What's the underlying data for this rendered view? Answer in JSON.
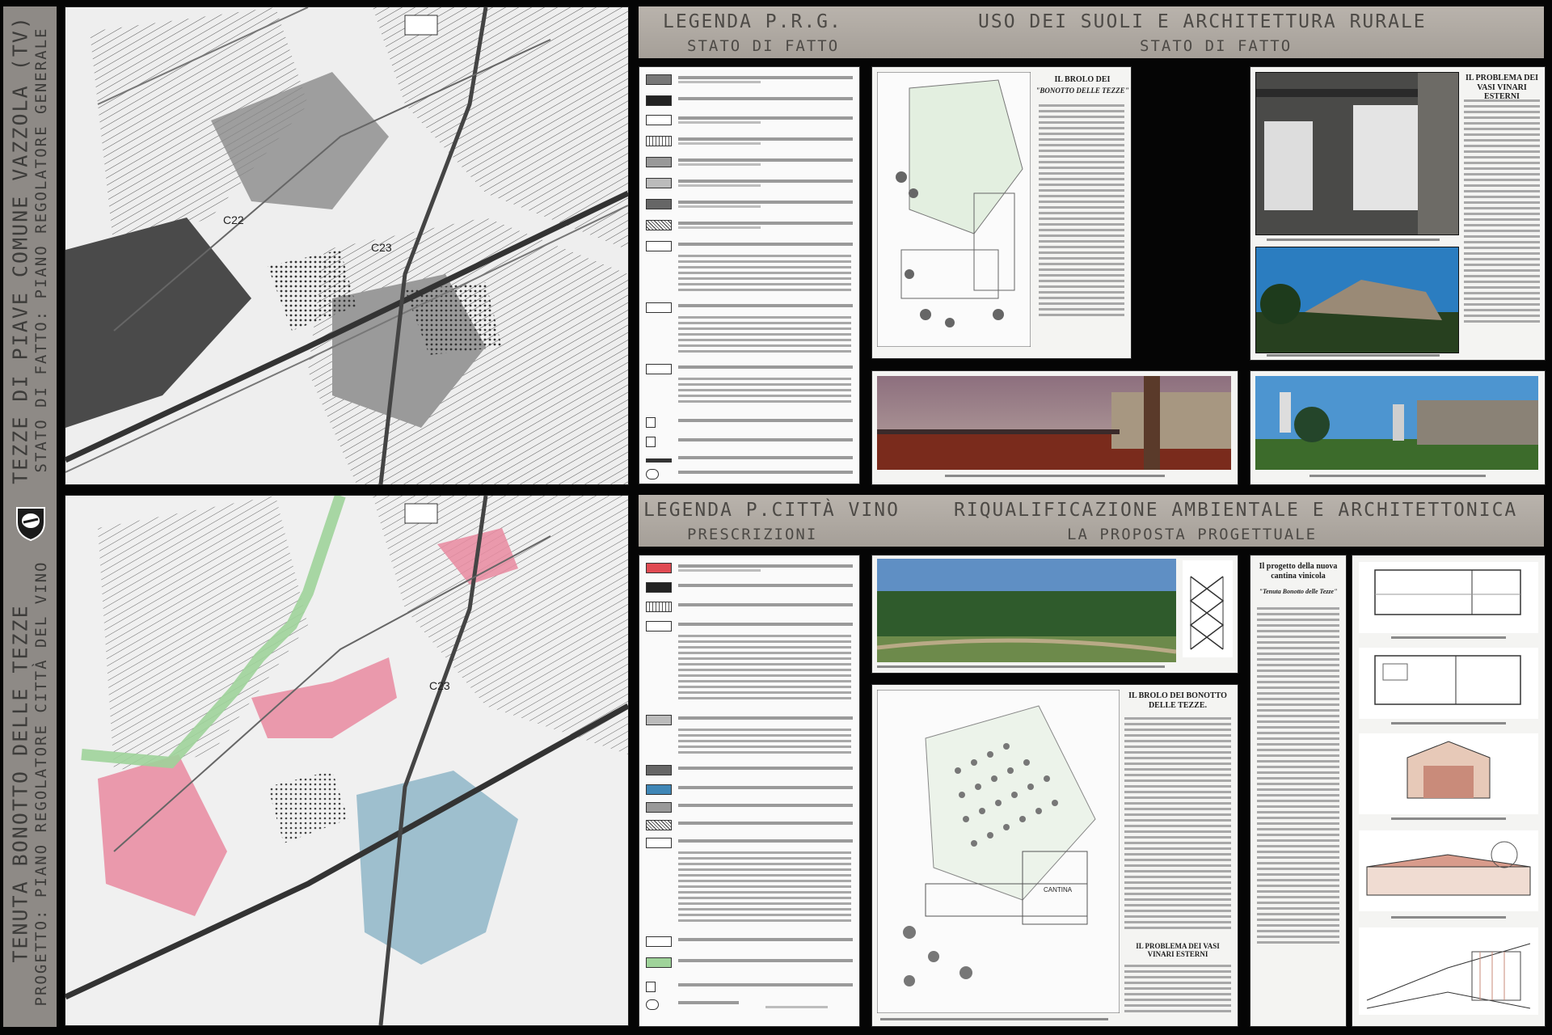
{
  "side_strip": {
    "line1": "TENUTA BONOTTO DELLE TEZZE",
    "line2": "PROGETTO: PIANO REGOLATORE CITTÀ DEL VINO",
    "line3": "TEZZE DI PIAVE COMUNE VAZZOLA (TV)",
    "line4": "STATO DI FATTO: PIANO REGOLATORE GENERALE"
  },
  "headers": {
    "legend_prg": "LEGENDA P.R.G.",
    "legend_prg_sub": "STATO DI FATTO",
    "uso_suoli": "USO DEI SUOLI E ARCHITETTURA RURALE",
    "uso_suoli_sub": "STATO DI FATTO",
    "legend_citta_vino": "LEGENDA P.CITTÀ VINO",
    "legend_citta_vino_sub": "PRESCRIZIONI",
    "riqualificazione": "RIQUALIFICAZIONE AMBIENTALE E ARCHITETTONICA",
    "riqualificazione_sub": "LA PROPOSTA PROGETTUALE"
  },
  "map_labels": {
    "c22": "C22",
    "c23": "C23"
  },
  "panels": {
    "brolo_top_title": "IL BROLO DEI",
    "brolo_top_sub": "\"BONOTTO DELLE TEZZE\"",
    "vasi_top_title": "IL PROBLEMA DEI VASI VINARI ESTERNI",
    "progetto_title": "Il progetto della nuova cantina vinicola",
    "progetto_sub": "\"Tenuta Bonotto delle Tezze\"",
    "brolo_bottom_title": "IL BROLO DEI BONOTTO DELLE TEZZE.",
    "vasi_bottom_title": "IL PROBLEMA DEI VASI VINARI ESTERNI",
    "cantina_label": "CANTINA"
  },
  "colors": {
    "zone_red": "#e98aa0",
    "zone_green": "#9fd39a",
    "zone_blue": "#8fb6c8",
    "header_bar": "#aca69f",
    "legend_red": "#e04a52",
    "legend_blue": "#3f86b6"
  }
}
